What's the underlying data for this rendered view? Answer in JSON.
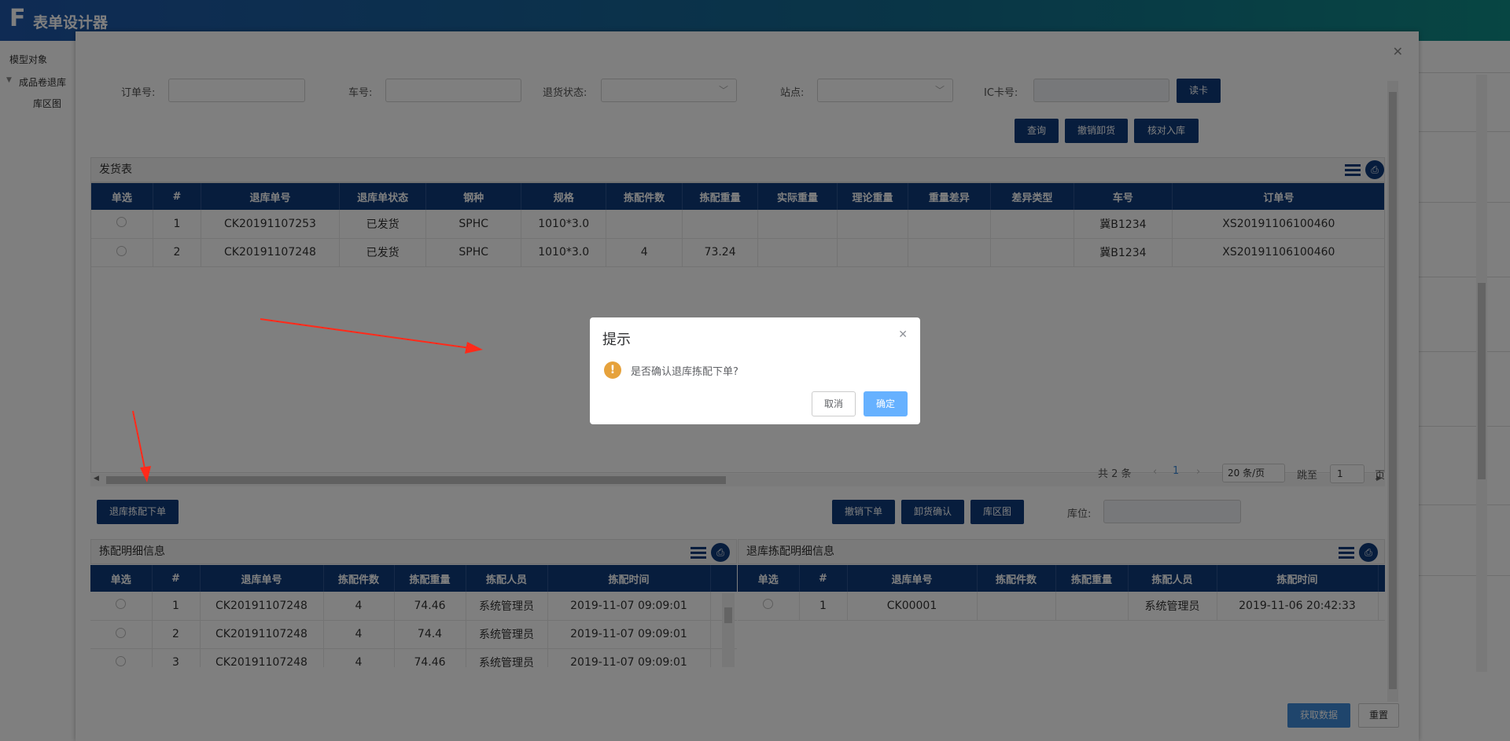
{
  "app": {
    "logo": "F",
    "title": "表单设计器"
  },
  "left_panel": {
    "model_label": "模型对象",
    "tree_root": "成品卷退库",
    "tree_child": "库区图"
  },
  "form": {
    "order_label": "订单号:",
    "car_label": "车号:",
    "return_status_label": "退货状态:",
    "station_label": "站点:",
    "ic_label": "IC卡号:",
    "read_card_button": "读卡",
    "query_button": "查询",
    "cancel_unload_button": "撤销卸货",
    "check_in_button": "核对入库"
  },
  "shipping": {
    "title": "发货表",
    "columns": [
      "单选",
      "#",
      "退库单号",
      "退库单状态",
      "钢种",
      "规格",
      "拣配件数",
      "拣配重量",
      "实际重量",
      "理论重量",
      "重量差异",
      "差异类型",
      "车号",
      "订单号"
    ],
    "rows": [
      [
        "",
        "1",
        "CK20191107253",
        "已发货",
        "SPHC",
        "1010*3.0",
        "",
        "",
        "",
        "",
        "",
        "",
        "冀B1234",
        "XS20191106100460"
      ],
      [
        "",
        "2",
        "CK20191107248",
        "已发货",
        "SPHC",
        "1010*3.0",
        "4",
        "73.24",
        "",
        "",
        "",
        "",
        "冀B1234",
        "XS20191106100460"
      ]
    ]
  },
  "pager": {
    "total": "共 2 条",
    "current_page": "1",
    "page_size": "20 条/页",
    "jump_label": "跳至",
    "jump_value": "1",
    "page_suffix": "页"
  },
  "actions": {
    "return_pick_order_button": "退库拣配下单",
    "cancel_order_button": "撤销下单",
    "unload_confirm_button": "卸货确认",
    "warehouse_map_button": "库区图",
    "location_label": "库位:"
  },
  "pick_detail": {
    "title": "拣配明细信息",
    "columns": [
      "单选",
      "#",
      "退库单号",
      "拣配件数",
      "拣配重量",
      "拣配人员",
      "拣配时间"
    ],
    "rows": [
      [
        "",
        "1",
        "CK20191107248",
        "4",
        "74.46",
        "系统管理员",
        "2019-11-07 09:09:01"
      ],
      [
        "",
        "2",
        "CK20191107248",
        "4",
        "74.4",
        "系统管理员",
        "2019-11-07 09:09:01"
      ],
      [
        "",
        "3",
        "CK20191107248",
        "4",
        "74.46",
        "系统管理员",
        "2019-11-07 09:09:01"
      ]
    ]
  },
  "return_pick_detail": {
    "title": "退库拣配明细信息",
    "columns": [
      "单选",
      "#",
      "退库单号",
      "拣配件数",
      "拣配重量",
      "拣配人员",
      "拣配时间"
    ],
    "rows": [
      [
        "",
        "1",
        "CK00001",
        "",
        "",
        "系统管理员",
        "2019-11-06 20:42:33"
      ]
    ]
  },
  "footer": {
    "fetch_button": "获取数据",
    "reset_button": "重置"
  },
  "confirm": {
    "title": "提示",
    "message": "是否确认退库拣配下单?",
    "cancel_button": "取消",
    "ok_button": "确定"
  },
  "colors": {
    "header_blue": "#0f3b7a",
    "accent": "#3e8ad8",
    "warning": "#e6a23c",
    "arrow": "#ff2a1a"
  }
}
